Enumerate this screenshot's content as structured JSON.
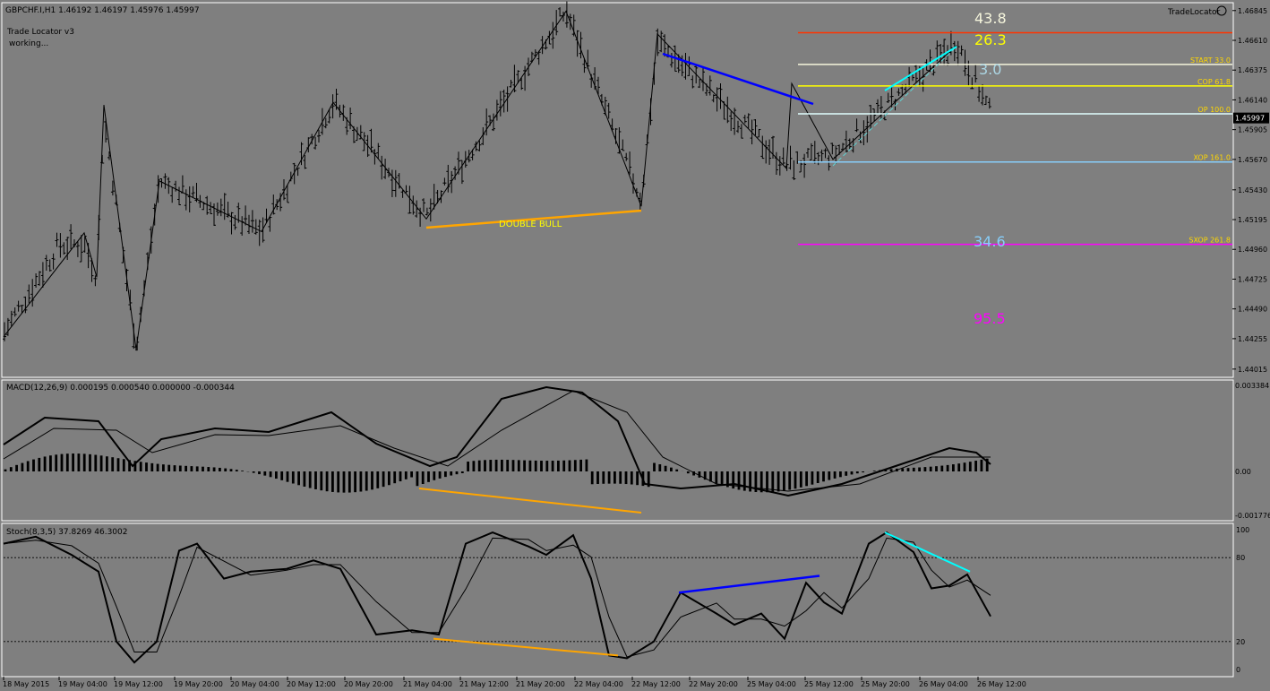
{
  "symbol_header": "GBPCHF.I,H1  1.46192 1.46197 1.45976 1.45997",
  "indicator": {
    "name": "Trade Locator v3",
    "status": "working..."
  },
  "brand": "TradeLocator",
  "main_panel": {
    "ylim": [
      1.4395,
      1.469
    ],
    "price_ticks": [
      1.46845,
      1.4661,
      1.46375,
      1.4614,
      1.45905,
      1.4567,
      1.4543,
      1.45195,
      1.4496,
      1.44725,
      1.4449,
      1.44255,
      1.44015
    ],
    "tick_labels": [
      "1.46845",
      "1.46610",
      "1.46375",
      "1.46140",
      "1.45905",
      "1.45670",
      "1.45430",
      "1.45195",
      "1.44960",
      "1.44725",
      "1.44490",
      "1.44255",
      "1.44015"
    ],
    "current_price": "1.45997",
    "pattern_label": "DOUBLE BULL",
    "big_numbers": [
      {
        "text": "43.8",
        "color": "#f5f5dc"
      },
      {
        "text": "26.3",
        "color": "#ffff00"
      },
      {
        "text": "3.0",
        "color": "#add8e6"
      },
      {
        "text": "34.6",
        "color": "#87cefa"
      },
      {
        "text": "95.5",
        "color": "#ff00ff"
      }
    ],
    "levels": [
      {
        "label": "",
        "price": 1.4667,
        "color": "#ff3300"
      },
      {
        "label": "START 33.0",
        "price": 1.4642,
        "color": "#f5f5dc"
      },
      {
        "label": "COP 61.8",
        "price": 1.4625,
        "color": "#ffff00"
      },
      {
        "label": "OP 100.0",
        "price": 1.4603,
        "color": "#e0ffff"
      },
      {
        "label": "XOP 161.0",
        "price": 1.4565,
        "color": "#87cefa"
      },
      {
        "label": "SXOP 261.8",
        "price": 1.45,
        "color": "#ff00ff"
      }
    ]
  },
  "macd_panel": {
    "title": "MACD(12,26,9) 0.000195 0.000540 0.000000 -0.000344",
    "tick_labels": [
      "0.003384",
      "0.00",
      "-0.001776"
    ]
  },
  "stoch_panel": {
    "title": "Stoch(8,3,5) 37.8269 46.3002",
    "tick_labels": [
      "100",
      "80",
      "20",
      "0"
    ]
  },
  "time_axis": [
    "18 May 2015",
    "19 May 04:00",
    "19 May 12:00",
    "19 May 20:00",
    "20 May 04:00",
    "20 May 12:00",
    "20 May 20:00",
    "21 May 04:00",
    "21 May 12:00",
    "21 May 20:00",
    "22 May 04:00",
    "22 May 12:00",
    "22 May 20:00",
    "25 May 04:00",
    "25 May 12:00",
    "25 May 20:00",
    "26 May 04:00",
    "26 May 12:00"
  ],
  "colors": {
    "background": "#7f7f7f",
    "candles": "#000000",
    "bull_line": "#ffa500",
    "bear_line": "#0000ff",
    "div_line": "#00ffff"
  },
  "chart_data": {
    "type": "line",
    "title": "GBPCHF.I,H1",
    "ylabel": "",
    "xlabel": "",
    "ylim": [
      1.4395,
      1.469
    ],
    "zigzag": [
      {
        "x": "18 May 2015",
        "y": 1.4427
      },
      {
        "x": "19 May 04:00",
        "y": 1.4509
      },
      {
        "x": "19 May 04:00",
        "y": 1.4474
      },
      {
        "x": "19 May 06:00",
        "y": 1.461
      },
      {
        "x": "19 May 12:00",
        "y": 1.4417
      },
      {
        "x": "19 May 16:00",
        "y": 1.455
      },
      {
        "x": "20 May 04:00",
        "y": 1.451
      },
      {
        "x": "20 May 12:00",
        "y": 1.4612
      },
      {
        "x": "21 May 04:00",
        "y": 1.452
      },
      {
        "x": "21 May 20:00",
        "y": 1.4684
      },
      {
        "x": "22 May 12:00",
        "y": 1.453
      },
      {
        "x": "22 May 12:00",
        "y": 1.4666
      },
      {
        "x": "25 May 04:00",
        "y": 1.456
      },
      {
        "x": "25 May 04:00",
        "y": 1.4627
      },
      {
        "x": "25 May 12:00",
        "y": 1.4567
      },
      {
        "x": "26 May 04:00",
        "y": 1.4657
      }
    ],
    "series": [
      {
        "name": "MACD(12,26,9)",
        "last_values": [
          0.000195,
          0.00054,
          0.0,
          -0.000344
        ]
      },
      {
        "name": "Stoch(8,3,5)",
        "last_values": [
          37.8269,
          46.3002
        ]
      }
    ]
  }
}
